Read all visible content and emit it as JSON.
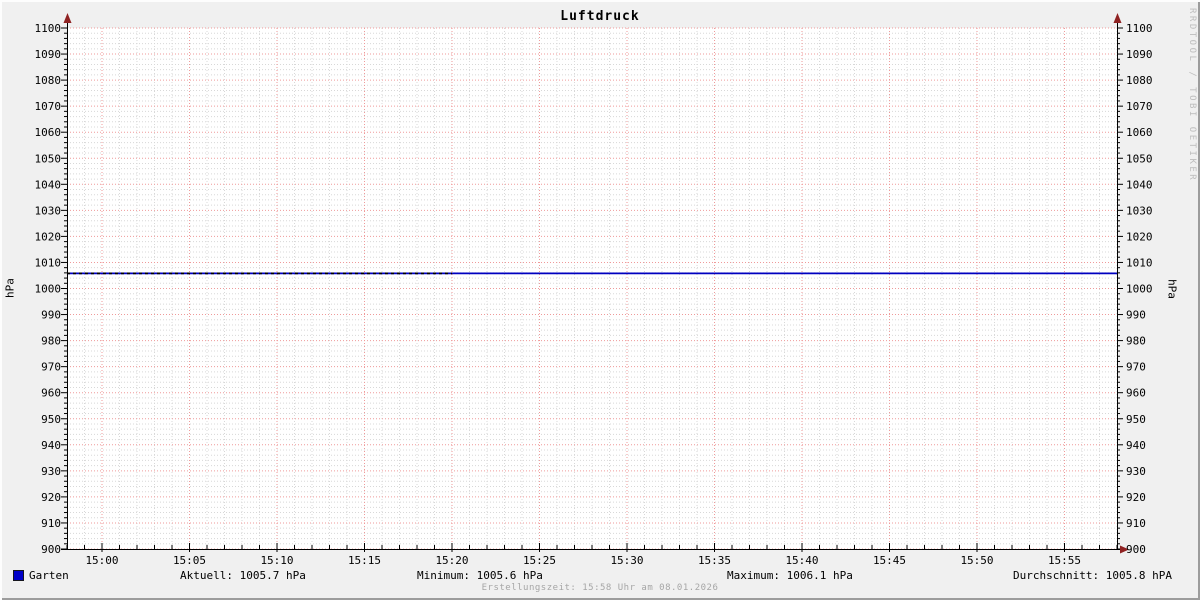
{
  "chart_data": {
    "type": "line",
    "title": "Luftdruck",
    "ylabel": "hPa",
    "ylabel_right": "hPa",
    "ylim": [
      900,
      1100
    ],
    "y_major_step": 10,
    "y_minor_step": 2,
    "x_ticks": [
      "15:00",
      "15:05",
      "15:10",
      "15:15",
      "15:20",
      "15:25",
      "15:30",
      "15:35",
      "15:40",
      "15:45",
      "15:50",
      "15:55"
    ],
    "x_tick_step_minutes": 5,
    "x_minor_step_minutes": 1,
    "x_range_minutes": [
      -2,
      58
    ],
    "grid": true,
    "legend_position": "bottom",
    "series": [
      {
        "name": "Garten",
        "color": "#0000c0",
        "points_minutes_hpa": [
          [
            -2,
            1005.8
          ],
          [
            58,
            1005.8
          ]
        ],
        "black_overlay_until_minute": 20
      }
    ],
    "stats": {
      "aktuell_hpa": 1005.7,
      "minimum_hpa": 1005.6,
      "maximum_hpa": 1006.1,
      "durchschnitt_hpa": 1005.8
    }
  },
  "legend": {
    "series_label": "Garten",
    "series_color": "#0000c8",
    "stats": [
      {
        "text": "Aktuell: 1005.7 hPa"
      },
      {
        "text": "Minimum: 1005.6 hPa"
      },
      {
        "text": "Maximum: 1006.1 hPa"
      },
      {
        "text": "Durchschnitt: 1005.8 hPA"
      }
    ]
  },
  "footer": {
    "text": "Erstellungszeit: 15:58 Uhr am 08.01.2026"
  },
  "watermark": {
    "text": "RRDTOOL / TOBI OETIKER"
  },
  "colors": {
    "background": "#f0f0f0",
    "canvas": "#ffffff",
    "grid_major": "#ef9a9a",
    "grid_minor": "#d8d8d8",
    "axis": "#000000",
    "arrow": "#8f2222",
    "line_blue": "#0000c0",
    "line_overlay": "#000000",
    "footer_text": "#a6a6a6",
    "watermark_text": "#bdbdbd"
  }
}
